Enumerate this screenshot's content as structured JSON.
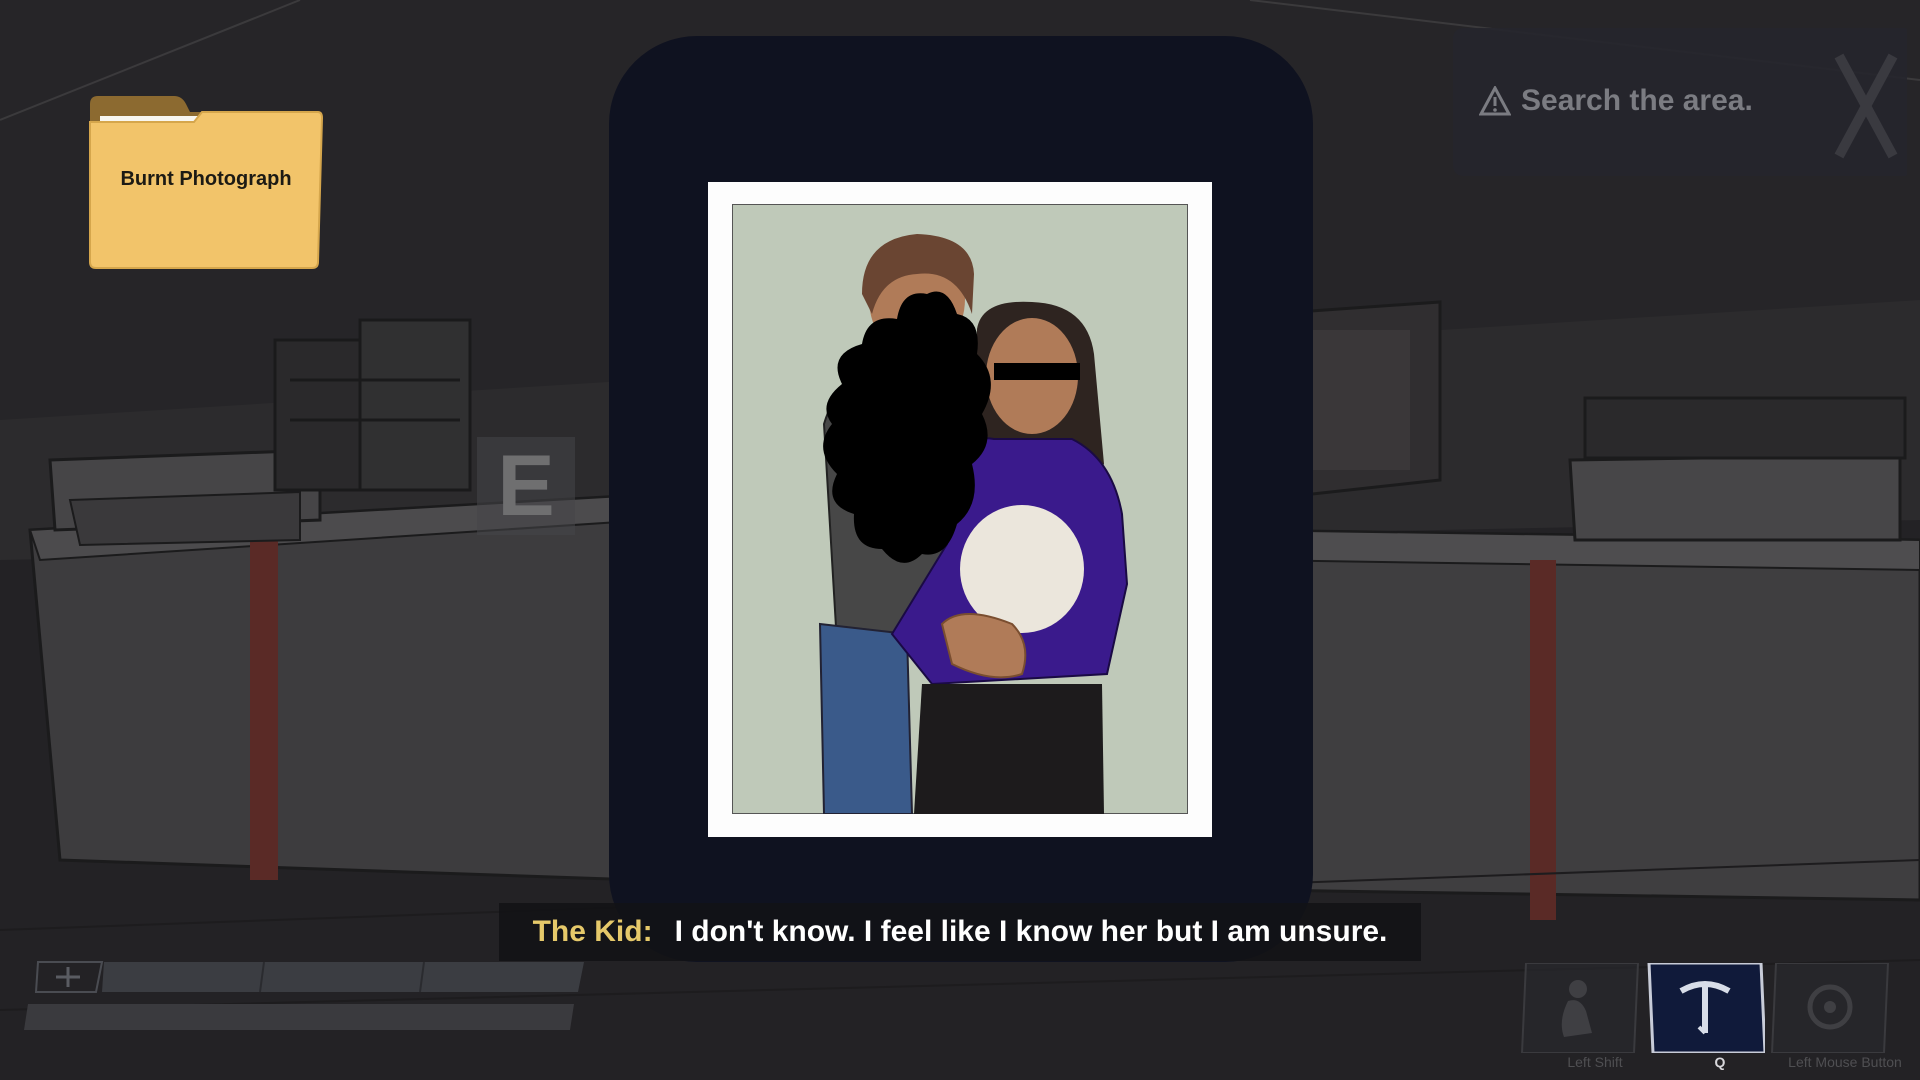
{
  "document": {
    "title": "Burnt Photograph"
  },
  "objective": {
    "text": "Search the area.",
    "icon": "warning-triangle-icon"
  },
  "interact_prompt": {
    "key": "E"
  },
  "dialogue": {
    "speaker": "The Kid:",
    "line": "I don't know. I feel like I know her but I am unsure."
  },
  "abilities": [
    {
      "icon": "crouch-icon",
      "label": "Left Shift",
      "active": false
    },
    {
      "icon": "sign-glyph-icon",
      "label": "Q",
      "active": true
    },
    {
      "icon": "gear-target-icon",
      "label": "Left Mouse Button",
      "active": false
    }
  ],
  "colors": {
    "speaker": "#e6c96a",
    "dialogue_text": "#ffffff",
    "viewer_bg": "#0f1220",
    "folder": "#f2c46a",
    "active_ability": "#1a2a5a",
    "photo_bg": "#bfc9b9",
    "sweater": "#3a1a8c"
  }
}
